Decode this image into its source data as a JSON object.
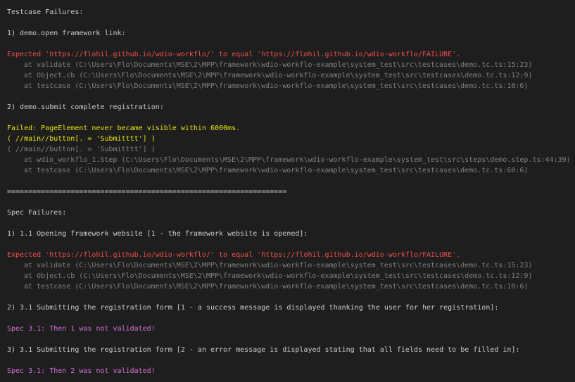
{
  "colors": {
    "background": "#1e1e1e",
    "default": "#cccccc",
    "error": "#f14c4c",
    "stack": "#808080",
    "warning": "#e5e510",
    "spec": "#d670d6"
  },
  "testcase_section": {
    "heading": "Testcase Failures:",
    "failures": [
      {
        "title": "1) demo.open framework link:",
        "message": "Expected 'https://flohil.github.io/wdio-workflo/' to equal 'https://flohil.github.io/wdio-workflo/FAILURE'.",
        "stack": [
          "at validate (C:\\Users\\Flo\\Documents\\MSE\\2\\MPP\\framework\\wdio-workflo-example\\system_test\\src\\testcases\\demo.tc.ts:15:23)",
          "at Object.cb (C:\\Users\\Flo\\Documents\\MSE\\2\\MPP\\framework\\wdio-workflo-example\\system_test\\src\\testcases\\demo.tc.ts:12:9)",
          "at testcase (C:\\Users\\Flo\\Documents\\MSE\\2\\MPP\\framework\\wdio-workflo-example\\system_test\\src\\testcases\\demo.tc.ts:10:6)"
        ]
      },
      {
        "title": "2) demo.submit complete registration:",
        "message": "Failed: PageElement never became visible within 6000ms.",
        "selector": "( //main//button[. = 'Submitttt'] )",
        "selector_repeat": "( //main//button[. = 'Submitttt'] )",
        "stack": [
          "at wdio_workflo_1.Step (C:\\Users\\Flo\\Documents\\MSE\\2\\MPP\\framework\\wdio-workflo-example\\system_test\\src\\steps\\demo.step.ts:44:39)",
          "at testcase (C:\\Users\\Flo\\Documents\\MSE\\2\\MPP\\framework\\wdio-workflo-example\\system_test\\src\\testcases\\demo.tc.ts:60:6)"
        ]
      }
    ]
  },
  "separator": "==================================================================",
  "spec_section": {
    "heading": "Spec Failures:",
    "failures": [
      {
        "title": "1) 1.1 Opening framework website [1 - the framework website is opened]:",
        "message": "Expected 'https://flohil.github.io/wdio-workflo/' to equal 'https://flohil.github.io/wdio-workflo/FAILURE'.",
        "stack": [
          "at validate (C:\\Users\\Flo\\Documents\\MSE\\2\\MPP\\framework\\wdio-workflo-example\\system_test\\src\\testcases\\demo.tc.ts:15:23)",
          "at Object.cb (C:\\Users\\Flo\\Documents\\MSE\\2\\MPP\\framework\\wdio-workflo-example\\system_test\\src\\testcases\\demo.tc.ts:12:9)",
          "at testcase (C:\\Users\\Flo\\Documents\\MSE\\2\\MPP\\framework\\wdio-workflo-example\\system_test\\src\\testcases\\demo.tc.ts:10:6)"
        ]
      },
      {
        "title": "2) 3.1 Submitting the registration form [1 - a success message is displayed thanking the user for her registration]:",
        "message": "Spec 3.1: Then 1 was not validated!"
      },
      {
        "title": "3) 3.1 Submitting the registration form [2 - an error message is displayed stating that all fields need to be filled in]:",
        "message": "Spec 3.1: Then 2 was not validated!"
      }
    ]
  }
}
